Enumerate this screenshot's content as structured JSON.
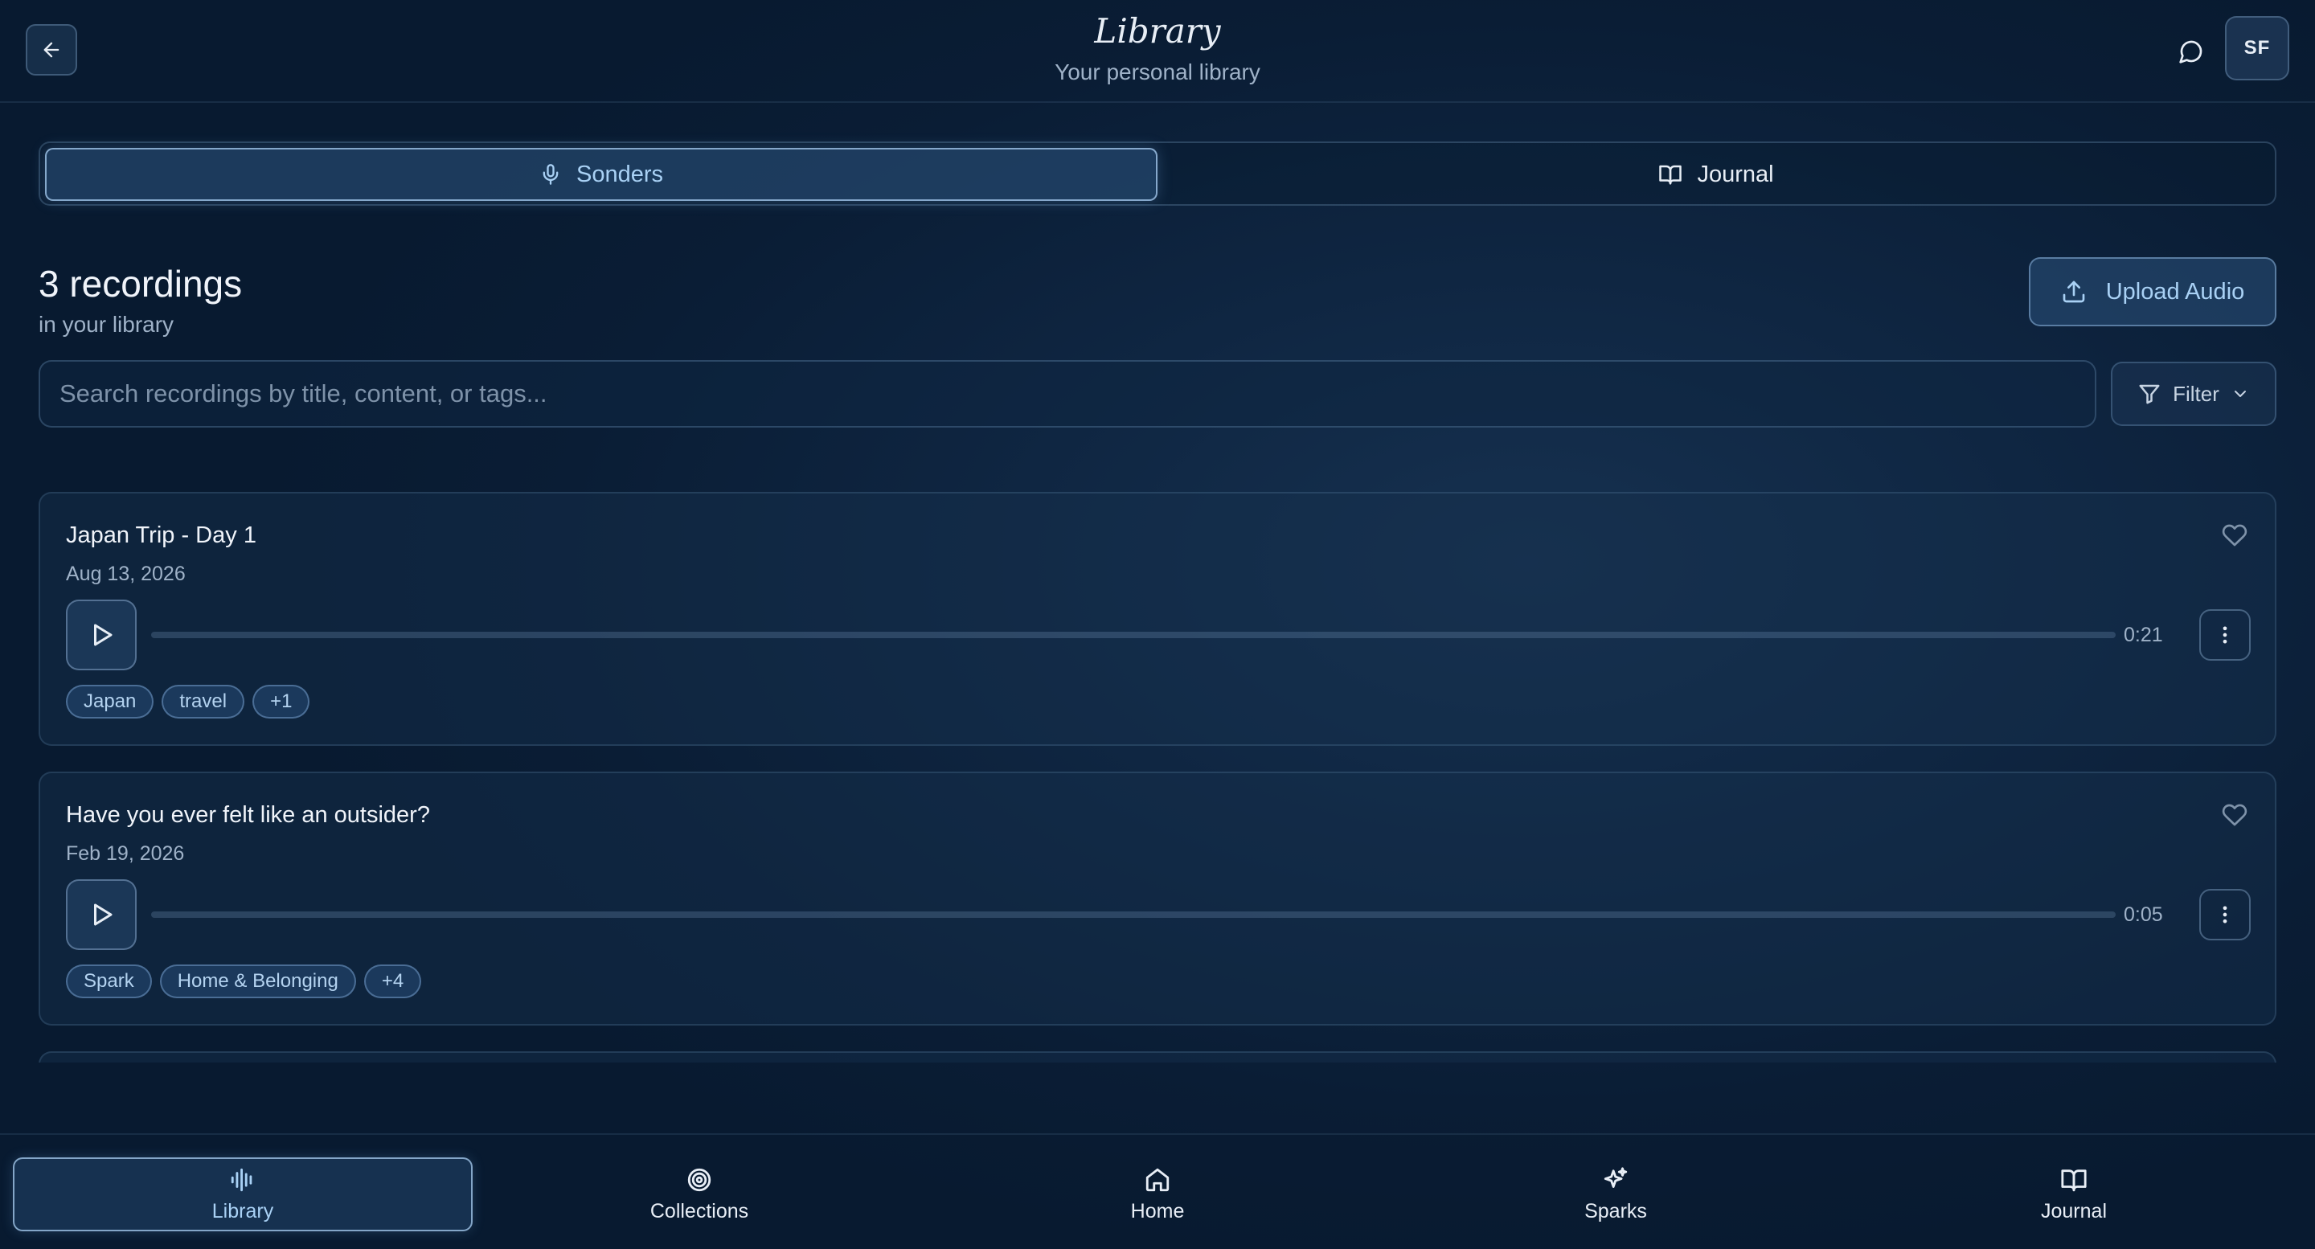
{
  "header": {
    "title": "Library",
    "subtitle": "Your personal library",
    "avatar_initials": "SF"
  },
  "tabs": [
    {
      "label": "Sonders",
      "icon": "mic-icon",
      "active": true
    },
    {
      "label": "Journal",
      "icon": "book-open-icon",
      "active": false
    }
  ],
  "summary": {
    "count_title": "3 recordings",
    "count_subtitle": "in your library"
  },
  "upload": {
    "label": "Upload Audio"
  },
  "search": {
    "placeholder": "Search recordings by title, content, or tags..."
  },
  "filter": {
    "label": "Filter"
  },
  "recordings": [
    {
      "title": "Japan Trip - Day 1",
      "date": "Aug 13, 2026",
      "duration": "0:21",
      "progress": 0,
      "tags": [
        "Japan",
        "travel",
        "+1"
      ]
    },
    {
      "title": "Have you ever felt like an outsider?",
      "date": "Feb 19, 2026",
      "duration": "0:05",
      "progress": 0,
      "tags": [
        "Spark",
        "Home & Belonging",
        "+4"
      ]
    }
  ],
  "bottom_nav": [
    {
      "label": "Library",
      "icon": "waveform-icon",
      "active": true
    },
    {
      "label": "Collections",
      "icon": "target-icon",
      "active": false
    },
    {
      "label": "Home",
      "icon": "home-icon",
      "active": false
    },
    {
      "label": "Sparks",
      "icon": "sparkles-icon",
      "active": false
    },
    {
      "label": "Journal",
      "icon": "book-open-icon",
      "active": false
    }
  ],
  "colors": {
    "background": "#0f2642",
    "accent": "#a9d1f5",
    "text": "#e8eef6",
    "muted": "#9fb2c8"
  }
}
